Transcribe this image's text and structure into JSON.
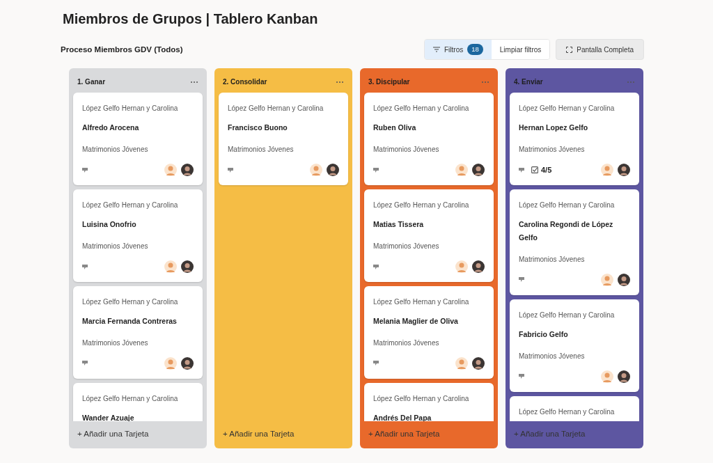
{
  "page": {
    "title": "Miembros de Grupos | Tablero Kanban",
    "subtitle": "Proceso Miembros GDV (Todos)"
  },
  "toolbar": {
    "filters": {
      "label": "Filtros",
      "count": "18",
      "active": true
    },
    "clear": "Limpiar filtros",
    "fullscreen": "Pantalla Completa"
  },
  "columns": [
    {
      "title": "1. Ganar",
      "color": "#d9dadc",
      "add_label": "+ Añadir una Tarjeta",
      "cards": [
        {
          "group": "López Gelfo Hernan y Carolina",
          "name": "Alfredo Arocena",
          "category": "Matrimonios Jóvenes"
        },
        {
          "group": "López Gelfo Hernan y Carolina",
          "name": "Luisina Onofrio",
          "category": "Matrimonios Jóvenes"
        },
        {
          "group": "López Gelfo Hernan y Carolina",
          "name": "Marcia Fernanda Contreras",
          "category": "Matrimonios Jóvenes"
        },
        {
          "group": "López Gelfo Hernan y Carolina",
          "name": "Wander Azuaje"
        }
      ]
    },
    {
      "title": "2. Consolidar",
      "color": "#f5bd45",
      "add_label": "+ Añadir una Tarjeta",
      "cards": [
        {
          "group": "López Gelfo Hernan y Carolina",
          "name": "Francisco Buono",
          "category": "Matrimonios Jóvenes"
        }
      ]
    },
    {
      "title": "3. Discipular",
      "color": "#e8692b",
      "add_label": "+ Añadir una Tarjeta",
      "cards": [
        {
          "group": "López Gelfo Hernan y Carolina",
          "name": "Ruben Oliva",
          "category": "Matrimonios Jóvenes"
        },
        {
          "group": "López Gelfo Hernan y Carolina",
          "name": "Matias Tissera",
          "category": "Matrimonios Jóvenes"
        },
        {
          "group": "López Gelfo Hernan y Carolina",
          "name": "Melania Maglier de Oliva",
          "category": "Matrimonios Jóvenes"
        },
        {
          "group": "López Gelfo Hernan y Carolina",
          "name": "Andrés Del Papa"
        }
      ]
    },
    {
      "title": "4. Enviar",
      "color": "#5d56a1",
      "add_label": "+ Añadir una Tarjeta",
      "cards": [
        {
          "group": "López Gelfo Hernan y Carolina",
          "name": "Hernan Lopez Gelfo",
          "category": "Matrimonios Jóvenes",
          "checklist": "4/5"
        },
        {
          "group": "López Gelfo Hernan y Carolina",
          "name": "Carolina Regondi de López Gelfo",
          "category": "Matrimonios Jóvenes"
        },
        {
          "group": "López Gelfo Hernan y Carolina",
          "name": "Fabricio Gelfo",
          "category": "Matrimonios Jóvenes"
        },
        {
          "group": "López Gelfo Hernan y Carolina"
        }
      ]
    }
  ]
}
